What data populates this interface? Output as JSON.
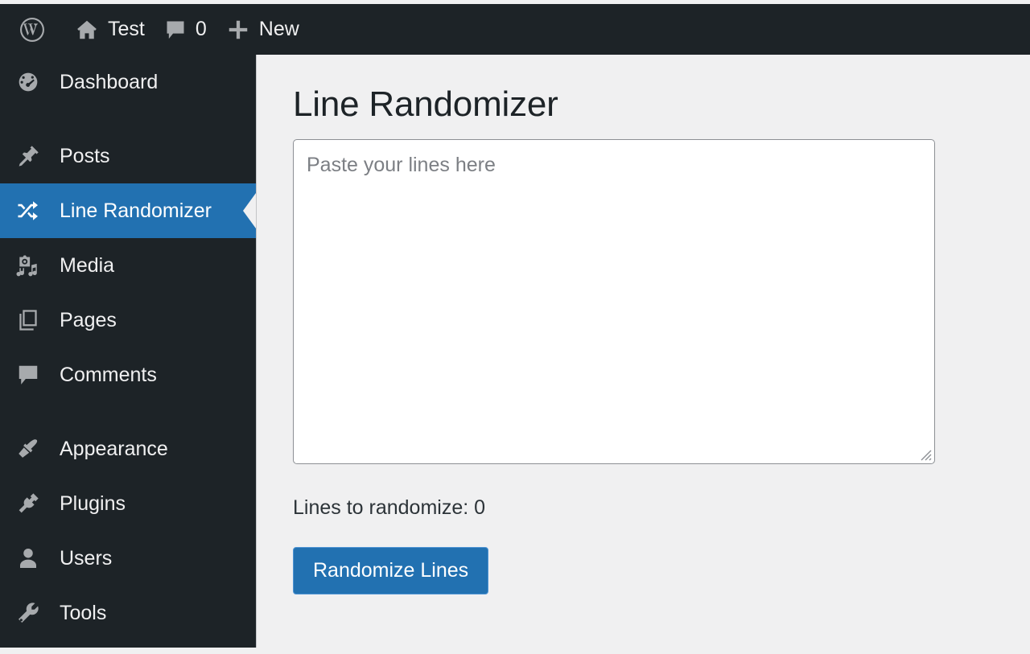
{
  "admin_bar": {
    "items": [
      {
        "icon": "wordpress-logo-icon",
        "label": ""
      },
      {
        "icon": "home-icon",
        "label": "Test"
      },
      {
        "icon": "comment-bubble-icon",
        "label": "0"
      },
      {
        "icon": "plus-icon",
        "label": "New"
      }
    ]
  },
  "sidebar": {
    "items": [
      {
        "icon": "dashboard-gauge-icon",
        "label": "Dashboard",
        "current": false,
        "separator_after": true
      },
      {
        "icon": "pin-icon",
        "label": "Posts",
        "current": false,
        "separator_after": false
      },
      {
        "icon": "shuffle-icon",
        "label": "Line Randomizer",
        "current": true,
        "separator_after": false
      },
      {
        "icon": "camera-music-icon",
        "label": "Media",
        "current": false,
        "separator_after": false
      },
      {
        "icon": "pages-icon",
        "label": "Pages",
        "current": false,
        "separator_after": false
      },
      {
        "icon": "comment-bubble-icon",
        "label": "Comments",
        "current": false,
        "separator_after": true
      },
      {
        "icon": "paintbrush-icon",
        "label": "Appearance",
        "current": false,
        "separator_after": false
      },
      {
        "icon": "plug-icon",
        "label": "Plugins",
        "current": false,
        "separator_after": false
      },
      {
        "icon": "user-icon",
        "label": "Users",
        "current": false,
        "separator_after": false
      },
      {
        "icon": "wrench-icon",
        "label": "Tools",
        "current": false,
        "separator_after": false
      }
    ]
  },
  "main": {
    "title": "Line Randomizer",
    "textarea": {
      "placeholder": "Paste your lines here",
      "value": ""
    },
    "count_label": "Lines to randomize: 0",
    "randomize_button": "Randomize Lines"
  },
  "colors": {
    "admin_dark": "#1d2327",
    "accent_blue": "#2271b1",
    "button_border": "#4f94d4",
    "content_bg": "#f0f0f1",
    "icon_gray": "#a7aaad"
  }
}
